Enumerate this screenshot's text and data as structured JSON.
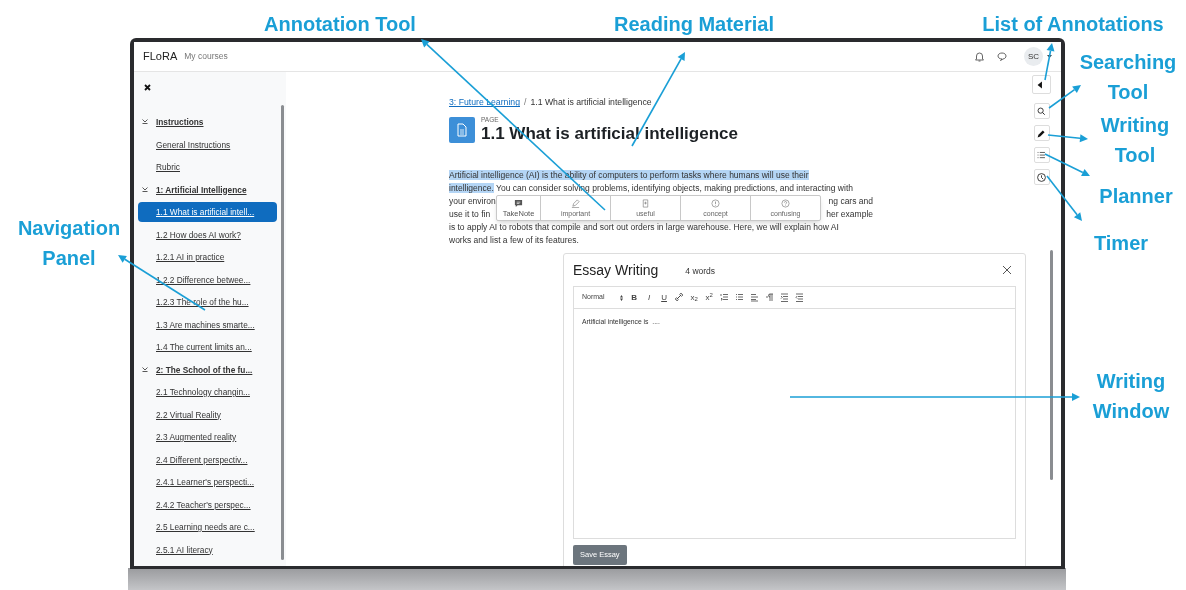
{
  "annotations": [
    {
      "label": "Annotation Tool"
    },
    {
      "label": "Reading Material"
    },
    {
      "label": "List of Annotations"
    },
    {
      "label": "Searching Tool"
    },
    {
      "label": "Writing Tool"
    },
    {
      "label": "Planner"
    },
    {
      "label": "Timer"
    },
    {
      "label": "Navigation Panel"
    },
    {
      "label": "Writing Window"
    }
  ],
  "top_bar": {
    "brand": "FLoRA",
    "link": "My courses",
    "avatar": "SC"
  },
  "sidebar": {
    "items": [
      {
        "label": "Instructions",
        "expanded": true,
        "selected": false,
        "children": [
          {
            "label": "General Instructions",
            "selected": false
          },
          {
            "label": "Rubric",
            "selected": false
          }
        ]
      },
      {
        "label": "1: Artificial Intelligence",
        "expanded": true,
        "selected": false,
        "children": [
          {
            "label": "1.1 What is artificial intell...",
            "selected": true
          },
          {
            "label": "1.2 How does AI work?",
            "selected": false
          },
          {
            "label": "1.2.1 AI in practice",
            "selected": false
          },
          {
            "label": "1.2.2 Difference betwee...",
            "selected": false
          },
          {
            "label": "1.2.3 The role of the hu...",
            "selected": false
          },
          {
            "label": "1.3 Are machines smarte...",
            "selected": false
          },
          {
            "label": "1.4 The current limits an...",
            "selected": false
          }
        ]
      },
      {
        "label": "2: The School of the fu...",
        "expanded": true,
        "selected": false,
        "children": [
          {
            "label": "2.1 Technology changin...",
            "selected": false
          },
          {
            "label": "2.2 Virtual Reality",
            "selected": false
          },
          {
            "label": "2.3 Augmented reality",
            "selected": false
          },
          {
            "label": "2.4 Different perspectiv...",
            "selected": false
          },
          {
            "label": "2.4.1 Learner's perspecti...",
            "selected": false
          },
          {
            "label": "2.4.2 Teacher's perspec...",
            "selected": false
          },
          {
            "label": "2.5 Learning needs are c...",
            "selected": false
          },
          {
            "label": "2.5.1 AI literacy",
            "selected": false
          }
        ]
      }
    ]
  },
  "breadcrumb": {
    "link": "3: Future Learning",
    "separator": "/",
    "current": "1.1 What is artificial intelligence"
  },
  "page": {
    "kind_label": "PAGE",
    "title": "1.1 What is artificial intelligence"
  },
  "paragraph_lines": [
    {
      "kind": "full",
      "segments": [
        {
          "text": "Artificial intelligence (AI) is the ability of computers to perform tasks where humans will use their",
          "highlighted": true
        }
      ]
    },
    {
      "kind": "full",
      "segments": [
        {
          "text": "intelligence.",
          "highlighted": true
        },
        {
          "text": " You can consider solving problems, identifying objects, making predictions, and interacting with",
          "highlighted": false
        }
      ]
    },
    {
      "kind": "split",
      "start": "your environ",
      "end": "ng cars and"
    },
    {
      "kind": "split",
      "start": "use it to fin",
      "end": "her example"
    },
    {
      "kind": "full",
      "segments": [
        {
          "text": "is to apply AI to robots that compile and sort out orders in large warehouse. Here, we will explain how AI",
          "highlighted": false
        }
      ]
    },
    {
      "kind": "full",
      "segments": [
        {
          "text": "works and list a few of its features.",
          "highlighted": false
        }
      ]
    }
  ],
  "annotation_menu": [
    {
      "kind": "note",
      "label": "TakeNote"
    },
    {
      "kind": "pencil",
      "label": "important"
    },
    {
      "kind": "bookmark",
      "label": "useful"
    },
    {
      "kind": "exclaim",
      "label": "concept"
    },
    {
      "kind": "question",
      "label": "confusing"
    }
  ],
  "tools": [
    {
      "kind": "toggle"
    },
    {
      "kind": "search"
    },
    {
      "kind": "pencil"
    },
    {
      "kind": "list"
    },
    {
      "kind": "clock"
    }
  ],
  "essay": {
    "title": "Essay Writing",
    "word_count": "4 words",
    "format": "Normal",
    "toolbar": [
      {
        "kind": "text",
        "label": "B"
      },
      {
        "kind": "text",
        "label": "I"
      },
      {
        "kind": "text",
        "label": "U"
      },
      {
        "kind": "link"
      },
      {
        "kind": "text",
        "label": "x$_{2}$"
      },
      {
        "kind": "text",
        "label": "x$^{2}$"
      },
      {
        "kind": "ol"
      },
      {
        "kind": "ul"
      },
      {
        "kind": "align"
      },
      {
        "kind": "para"
      },
      {
        "kind": "indent"
      },
      {
        "kind": "outdent"
      }
    ],
    "text": "Artificial intelligence is  ....",
    "save": "Save Essay"
  }
}
